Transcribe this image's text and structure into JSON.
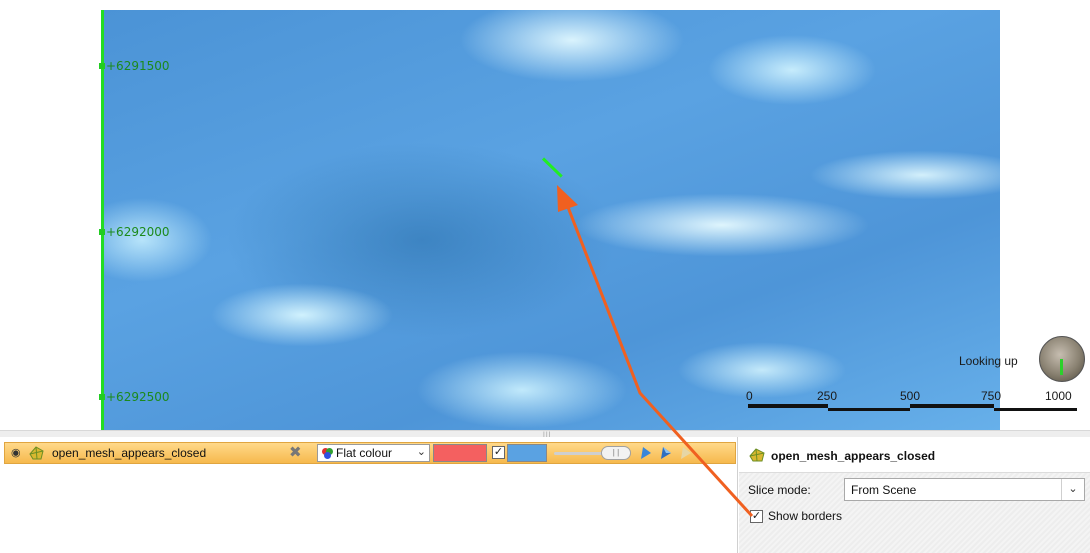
{
  "viewport": {
    "coordinates": [
      "+6291500",
      "+6292000",
      "+6292500"
    ],
    "view_label": "Looking up",
    "scale_bar": [
      "0",
      "250",
      "500",
      "750",
      "1000"
    ],
    "surface_color": "#5aa2e2",
    "axis_color": "#22dd22",
    "annotation_arrow_color": "#f06020"
  },
  "object_list": {
    "row": {
      "name": "open_mesh_appears_closed",
      "colour_mode": "Flat colour",
      "front_colour": "#f46060",
      "back_colour": "#5aa2e2",
      "back_colour_enabled": "✓",
      "icons": [
        "eye-icon",
        "mesh-icon",
        "remove-icon",
        "colour-mode-icon",
        "shading-icon"
      ]
    }
  },
  "properties": {
    "title": "open_mesh_appears_closed",
    "slice_mode_label": "Slice mode:",
    "slice_mode_value": "From Scene",
    "show_borders_label": "Show borders",
    "show_borders_checked": "✓"
  }
}
